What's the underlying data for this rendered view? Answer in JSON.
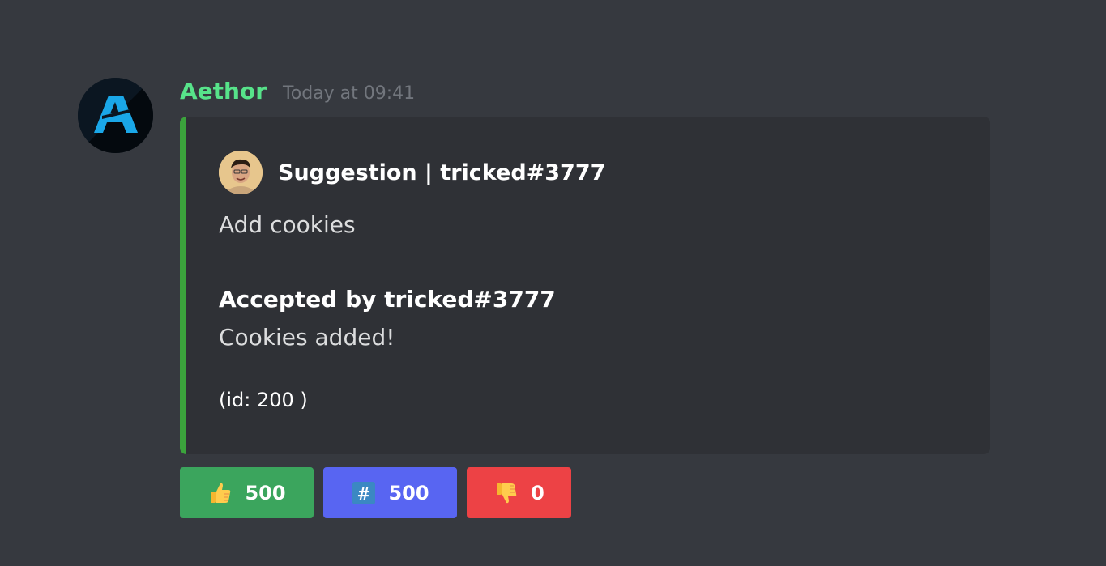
{
  "message": {
    "username": "Aethor",
    "timestamp": "Today at 09:41",
    "username_color": "#57e38a"
  },
  "embed": {
    "accent_color": "#3ba33c",
    "author": "Suggestion | tricked#3777",
    "description": "Add cookies",
    "field_name": "Accepted by tricked#3777",
    "field_value": "Cookies added!",
    "footer": "(id: 200 )"
  },
  "buttons": [
    {
      "icon": "thumbs-up-icon",
      "label": "500",
      "color": "#3ba55d"
    },
    {
      "icon": "hash-keycap-icon",
      "label": "500",
      "color": "#5865f2"
    },
    {
      "icon": "thumbs-down-icon",
      "label": "0",
      "color": "#ed4245"
    }
  ]
}
